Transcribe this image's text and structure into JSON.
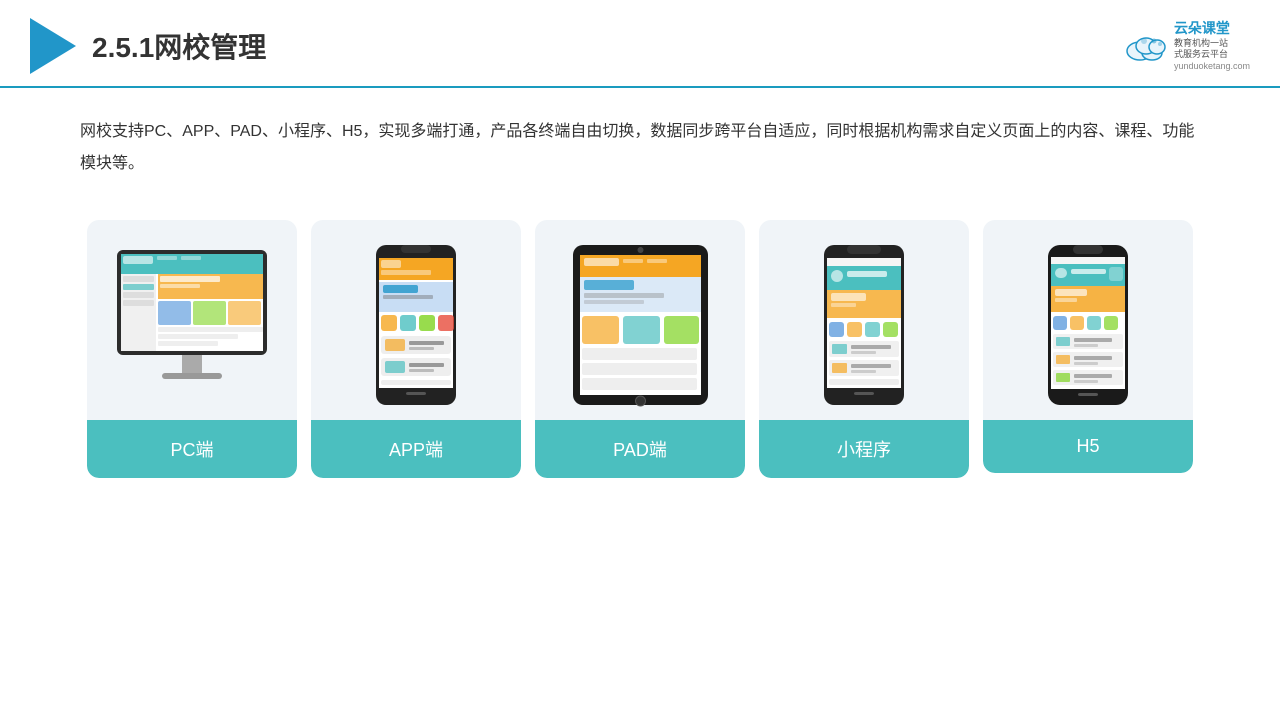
{
  "header": {
    "title": "2.5.1网校管理",
    "brand": {
      "name": "云朵课堂",
      "url": "yunduoketang.com",
      "slogan1": "教育机构一站",
      "slogan2": "式服务云平台"
    }
  },
  "description": {
    "text": "网校支持PC、APP、PAD、小程序、H5，实现多端打通，产品各终端自由切换，数据同步跨平台自适应，同时根据机构需求自定义页面上的内容、课程、功能模块等。"
  },
  "cards": [
    {
      "id": "pc",
      "label": "PC端"
    },
    {
      "id": "app",
      "label": "APP端"
    },
    {
      "id": "pad",
      "label": "PAD端"
    },
    {
      "id": "miniprogram",
      "label": "小程序"
    },
    {
      "id": "h5",
      "label": "H5"
    }
  ]
}
